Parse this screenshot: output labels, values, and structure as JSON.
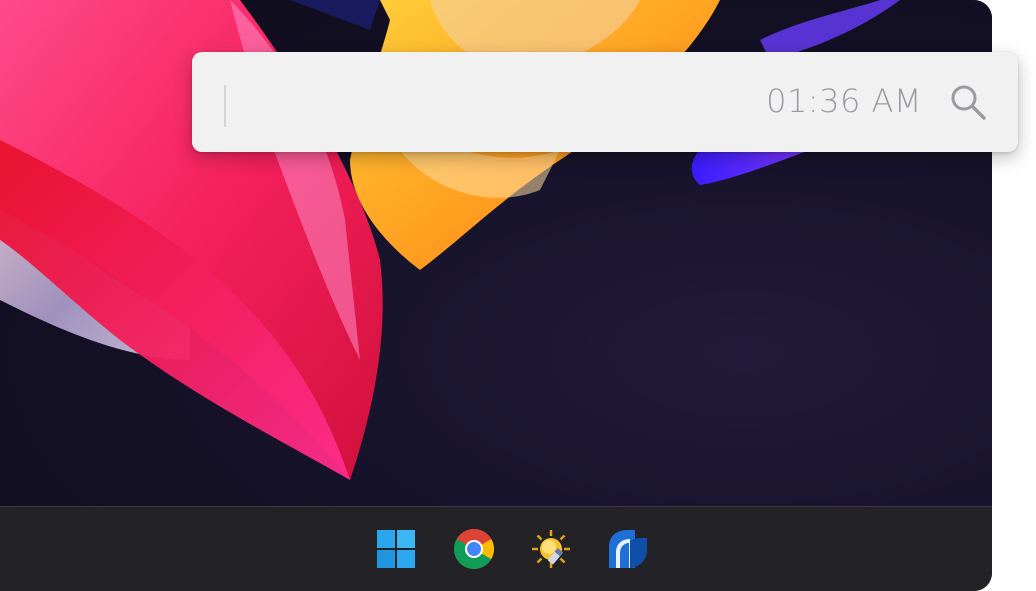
{
  "search": {
    "value": "",
    "placeholder": "",
    "clock": "01:36 AM",
    "icon": "search-icon"
  },
  "taskbar": {
    "items": [
      {
        "name": "start-button",
        "icon": "windows-logo-icon"
      },
      {
        "name": "chrome-button",
        "icon": "chrome-icon"
      },
      {
        "name": "weather-app-button",
        "icon": "sun-pencil-icon"
      },
      {
        "name": "blue-app-button",
        "icon": "blue-d-logo-icon"
      }
    ]
  },
  "colors": {
    "taskbar": "#232327",
    "panel": "#f1f1f2",
    "clock_text": "#9a9aa0",
    "windows_blue": "#29a6ee"
  }
}
